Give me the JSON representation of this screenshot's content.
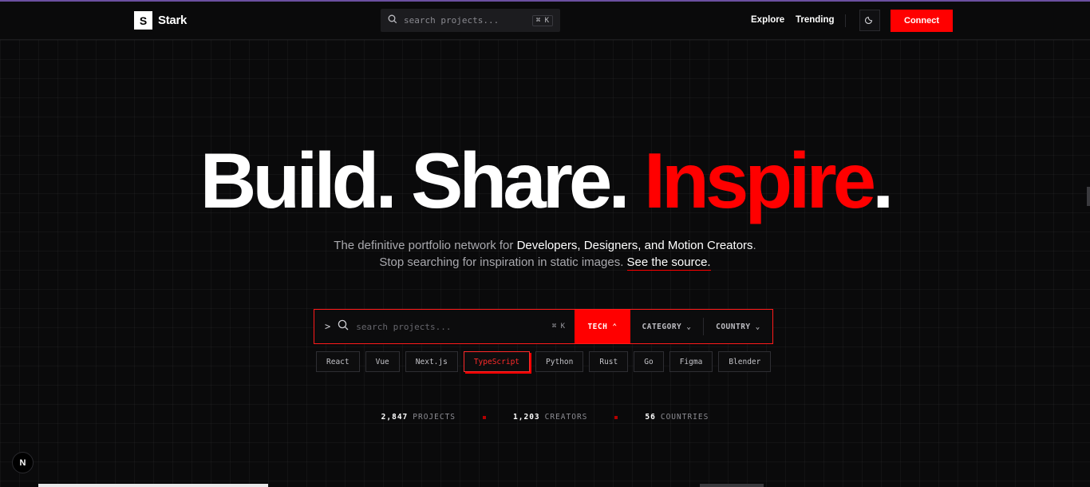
{
  "brand": {
    "mark": "S",
    "name": "Stark"
  },
  "header": {
    "search_placeholder": "search projects...",
    "search_shortcut": "⌘ K",
    "nav": [
      "Explore",
      "Trending"
    ],
    "connect_label": "Connect"
  },
  "hero": {
    "title_part1": "Build. Share. ",
    "title_red": "Inspire",
    "title_end": ".",
    "line1_prefix": "The definitive portfolio network for ",
    "line1_bold": "Developers, Designers, and Motion Creators",
    "line1_suffix": ".",
    "line2_prefix": "Stop searching for inspiration in static images. ",
    "line2_link": "See the source."
  },
  "searchbar": {
    "prompt": ">",
    "placeholder": "search projects...",
    "shortcut": "⌘ K",
    "filters": [
      {
        "label": "TECH",
        "chevron": "⌃"
      },
      {
        "label": "CATEGORY",
        "chevron": "⌄"
      },
      {
        "label": "COUNTRY",
        "chevron": "⌄"
      }
    ]
  },
  "chips": [
    "React",
    "Vue",
    "Next.js",
    "TypeScript",
    "Python",
    "Rust",
    "Go",
    "Figma",
    "Blender"
  ],
  "selected_chip": "TypeScript",
  "stats": [
    {
      "value": "2,847",
      "label": "PROJECTS"
    },
    {
      "value": "1,203",
      "label": "CREATORS"
    },
    {
      "value": "56",
      "label": "COUNTRIES"
    }
  ],
  "badge": "N",
  "colors": {
    "accent": "#ff0000",
    "background": "#0a0a0b"
  }
}
